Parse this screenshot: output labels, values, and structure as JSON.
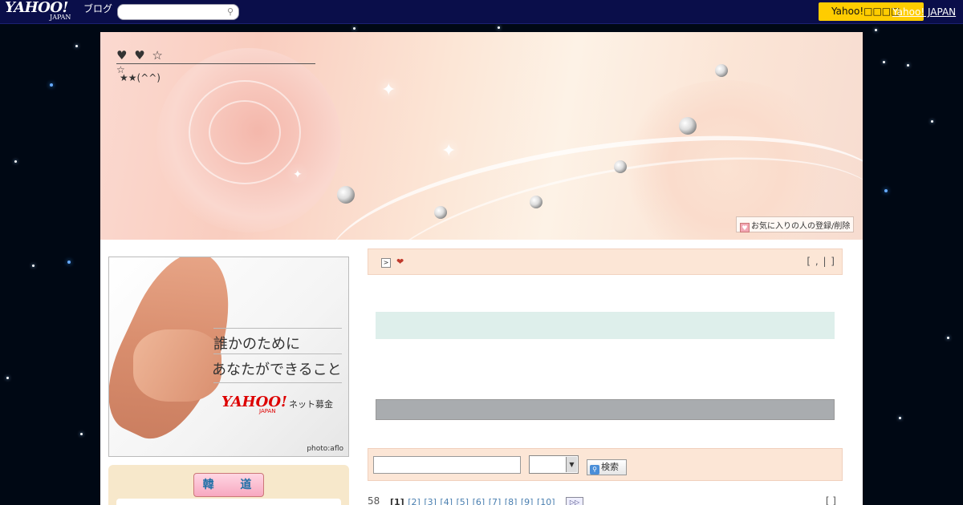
{
  "topbar": {
    "logo_text": "YAHOO!",
    "logo_sub": "JAPAN",
    "blog_label": "ブログ",
    "search_placeholder": "",
    "yahoo_button": "Yahoo!□□□□",
    "yahoo_link": "Yahoo! JAPAN"
  },
  "header": {
    "title": "♥ ♥ ☆",
    "subtitle_star": "☆",
    "subtitle": "★★(^^)",
    "favorite_button": "お気に入りの人の登録/削除"
  },
  "ad": {
    "line1": "誰かのために",
    "line2": "あなたができること",
    "brand": "YAHOO!",
    "brand_sub": "JAPAN",
    "service": "ネット募金",
    "credit": "photo:aflo"
  },
  "sidebar": {
    "button_label": "韓 道"
  },
  "post": {
    "arrow_icon": ">",
    "heart": "❤",
    "meta": "[ , | ]"
  },
  "search": {
    "keyword_value": "",
    "select_value": "",
    "button_label": "検索"
  },
  "pager": {
    "count": "58",
    "pages": [
      "[1]",
      "[2]",
      "[3]",
      "[4]",
      "[5]",
      "[6]",
      "[7]",
      "[8]",
      "[9]",
      "[10]"
    ],
    "bracket": "[ ]"
  },
  "colors": {
    "topbar": "#0a0e4a",
    "accent_yellow": "#ffcc00",
    "panel_peach": "#fce6d6",
    "sidebar_cream": "#f7e8cb"
  }
}
